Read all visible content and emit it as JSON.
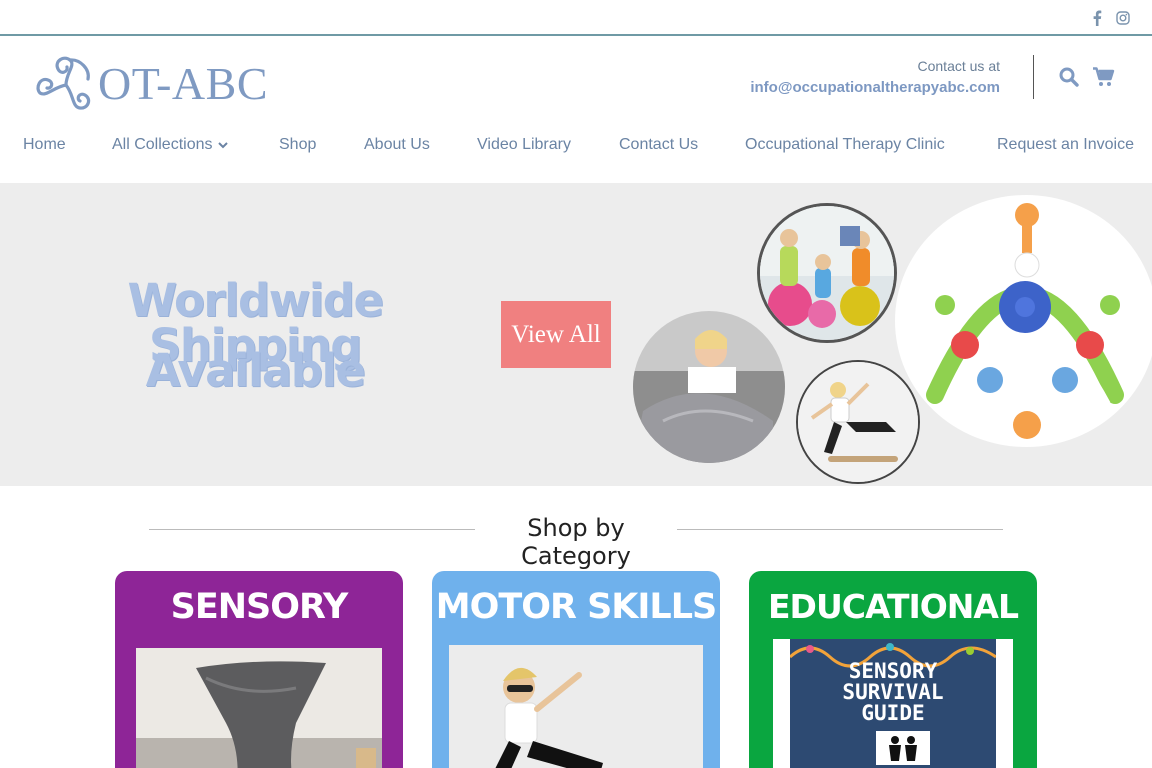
{
  "header": {
    "logo_text": "OT-ABC",
    "contact_label": "Contact us at",
    "contact_email": "info@occupationaltherapyabc.com"
  },
  "social": [
    {
      "icon": "facebook-icon"
    },
    {
      "icon": "instagram-icon"
    }
  ],
  "nav": {
    "items": [
      {
        "label": "Home"
      },
      {
        "label": "All Collections"
      },
      {
        "label": "Shop"
      },
      {
        "label": "About Us"
      },
      {
        "label": "Video Library"
      },
      {
        "label": "Contact Us"
      },
      {
        "label": "Occupational Therapy Clinic"
      },
      {
        "label": "Request an Invoice"
      }
    ]
  },
  "hero": {
    "title_line1": "Worldwide Shipping",
    "title_line2": "Available",
    "button_label": "View All"
  },
  "section": {
    "title": "Shop by Category"
  },
  "categories": [
    {
      "title": "SENSORY",
      "color": "#8e2597"
    },
    {
      "title": "MOTOR SKILLS",
      "color": "#6fb1ec"
    },
    {
      "title": "EDUCATIONAL",
      "color": "#0aa640",
      "book_title_1": "SENSORY",
      "book_title_2": "SURVIVAL",
      "book_title_3": "GUIDE"
    }
  ],
  "colors": {
    "accent": "#7f9ac2",
    "nav_text": "#6b84a4",
    "divider": "#6f9aa5",
    "button": "#f08080"
  }
}
